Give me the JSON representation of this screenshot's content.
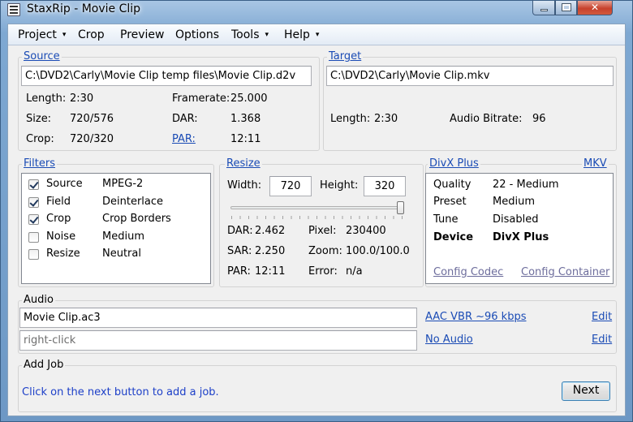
{
  "window": {
    "title": "StaxRip - Movie Clip"
  },
  "menu": [
    {
      "label": "Project",
      "has_submenu": true
    },
    {
      "label": "Crop",
      "has_submenu": false
    },
    {
      "label": "Preview",
      "has_submenu": false
    },
    {
      "label": "Options",
      "has_submenu": false
    },
    {
      "label": "Tools",
      "has_submenu": true
    },
    {
      "label": "Help",
      "has_submenu": true
    }
  ],
  "caret": "▾",
  "source": {
    "title": "Source",
    "path": "C:\\DVD2\\Carly\\Movie Clip temp files\\Movie Clip.d2v",
    "length_label": "Length:",
    "length": "2:30",
    "size_label": "Size:",
    "size": "720/576",
    "crop_label": "Crop:",
    "crop": "720/320",
    "framerate_label": "Framerate:",
    "framerate": "25.000",
    "dar_label": "DAR:",
    "dar": "1.368",
    "par_label": "PAR:",
    "par": "12:11"
  },
  "target": {
    "title": "Target",
    "path": "C:\\DVD2\\Carly\\Movie Clip.mkv",
    "length_label": "Length:",
    "length": "2:30",
    "audio_bitrate_label": "Audio Bitrate:",
    "audio_bitrate": "96"
  },
  "filters": {
    "title": "Filters",
    "items": [
      {
        "name": "Source",
        "value": "MPEG-2",
        "checked": true
      },
      {
        "name": "Field",
        "value": "Deinterlace",
        "checked": true
      },
      {
        "name": "Crop",
        "value": "Crop Borders",
        "checked": true
      },
      {
        "name": "Noise",
        "value": "Medium",
        "checked": false
      },
      {
        "name": "Resize",
        "value": "Neutral",
        "checked": false
      }
    ]
  },
  "resize": {
    "title": "Resize",
    "width_label": "Width:",
    "width": "720",
    "height_label": "Height:",
    "height": "320",
    "slider_level": 1.0,
    "dar_label": "DAR:",
    "dar": "2.462",
    "pixel_label": "Pixel:",
    "pixel": "230400",
    "sar_label": "SAR:",
    "sar": "2.250",
    "zoom_label": "Zoom:",
    "zoom": "100.0/100.0",
    "par_label": "PAR:",
    "par": "12:11",
    "error_label": "Error:",
    "error": "n/a"
  },
  "encoder": {
    "title": "DivX Plus",
    "container": "MKV",
    "rows": [
      {
        "key": "Quality",
        "value": "22 - Medium",
        "bold": false
      },
      {
        "key": "Preset",
        "value": "Medium",
        "bold": false
      },
      {
        "key": "Tune",
        "value": "Disabled",
        "bold": false
      },
      {
        "key": "Device",
        "value": "DivX Plus",
        "bold": true
      }
    ],
    "config_codec": "Config Codec",
    "config_container": "Config Container"
  },
  "audio": {
    "title": "Audio",
    "track1_file": "Movie Clip.ac3",
    "track1_profile": "AAC VBR ~96 kbps",
    "track1_edit": "Edit",
    "track2_placeholder": "right-click",
    "track2_profile": "No Audio",
    "track2_edit": "Edit"
  },
  "addjob": {
    "title": "Add Job",
    "hint": "Click on the next button to add a job.",
    "next_label": "Next"
  },
  "colors": {
    "link": "#1a4bb5",
    "info": "#1c3fc8",
    "window_frame": "#7ea8d2"
  }
}
